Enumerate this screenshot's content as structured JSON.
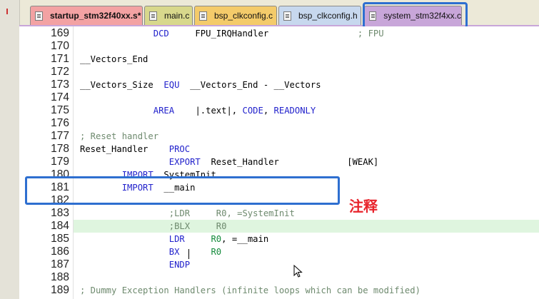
{
  "tabs": [
    {
      "label": "startup_stm32f40xx.s*",
      "color": "#f3a2a3"
    },
    {
      "label": "main.c",
      "color": "#d8d88c"
    },
    {
      "label": "bsp_clkconfig.c",
      "color": "#f4cb6a"
    },
    {
      "label": "bsp_clkconfig.h",
      "color": "#c7d8ee"
    },
    {
      "label": "system_stm32f4xx.c",
      "color": "#c8a6d9"
    }
  ],
  "annotation": "注释",
  "highlight_color": "#2e6fd0",
  "lines": [
    {
      "n": "169",
      "code": [
        {
          "t": "              "
        },
        {
          "t": "DCD",
          "c": "kw"
        },
        {
          "t": "     FPU_IRQHandler                 "
        },
        {
          "t": "; FPU",
          "c": "cm"
        }
      ]
    },
    {
      "n": "170",
      "code": []
    },
    {
      "n": "171",
      "code": [
        {
          "t": "__Vectors_End"
        }
      ]
    },
    {
      "n": "172",
      "code": []
    },
    {
      "n": "173",
      "code": [
        {
          "t": "__Vectors_Size  "
        },
        {
          "t": "EQU",
          "c": "kw"
        },
        {
          "t": "  __Vectors_End - __Vectors"
        }
      ]
    },
    {
      "n": "174",
      "code": []
    },
    {
      "n": "175",
      "code": [
        {
          "t": "              "
        },
        {
          "t": "AREA",
          "c": "kw"
        },
        {
          "t": "    |.text|, "
        },
        {
          "t": "CODE",
          "c": "kw"
        },
        {
          "t": ", "
        },
        {
          "t": "READONLY",
          "c": "kw"
        }
      ]
    },
    {
      "n": "176",
      "code": []
    },
    {
      "n": "177",
      "code": [
        {
          "t": "; Reset handler",
          "c": "cm"
        }
      ]
    },
    {
      "n": "178",
      "code": [
        {
          "t": "Reset_Handler    "
        },
        {
          "t": "PROC",
          "c": "kw"
        }
      ]
    },
    {
      "n": "179",
      "code": [
        {
          "t": "                 "
        },
        {
          "t": "EXPORT",
          "c": "kw"
        },
        {
          "t": "  Reset_Handler             [WEAK]"
        }
      ]
    },
    {
      "n": "180",
      "code": [
        {
          "t": "        "
        },
        {
          "t": "IMPORT",
          "c": "kw"
        },
        {
          "t": "  SystemInit"
        }
      ]
    },
    {
      "n": "181",
      "code": [
        {
          "t": "        "
        },
        {
          "t": "IMPORT",
          "c": "kw"
        },
        {
          "t": "  __main"
        }
      ]
    },
    {
      "n": "182",
      "code": []
    },
    {
      "n": "183",
      "code": [
        {
          "t": "                 "
        },
        {
          "t": ";LDR     R0, =SystemInit",
          "c": "cm"
        }
      ]
    },
    {
      "n": "184",
      "code": [
        {
          "t": "                 "
        },
        {
          "t": ";BLX     R0",
          "c": "cm"
        }
      ]
    },
    {
      "n": "185",
      "code": [
        {
          "t": "                 "
        },
        {
          "t": "LDR",
          "c": "kw"
        },
        {
          "t": "     "
        },
        {
          "t": "R0",
          "c": "num"
        },
        {
          "t": ", =__main"
        }
      ]
    },
    {
      "n": "186",
      "code": [
        {
          "t": "                 "
        },
        {
          "t": "BX",
          "c": "kw"
        },
        {
          "t": "      "
        },
        {
          "t": "R0",
          "c": "num"
        }
      ]
    },
    {
      "n": "187",
      "code": [
        {
          "t": "                 "
        },
        {
          "t": "ENDP",
          "c": "kw"
        }
      ]
    },
    {
      "n": "188",
      "code": []
    },
    {
      "n": "189",
      "code": [
        {
          "t": "; Dummy Exception Handlers (infinite loops which can be modified)",
          "c": "cm"
        }
      ]
    }
  ]
}
